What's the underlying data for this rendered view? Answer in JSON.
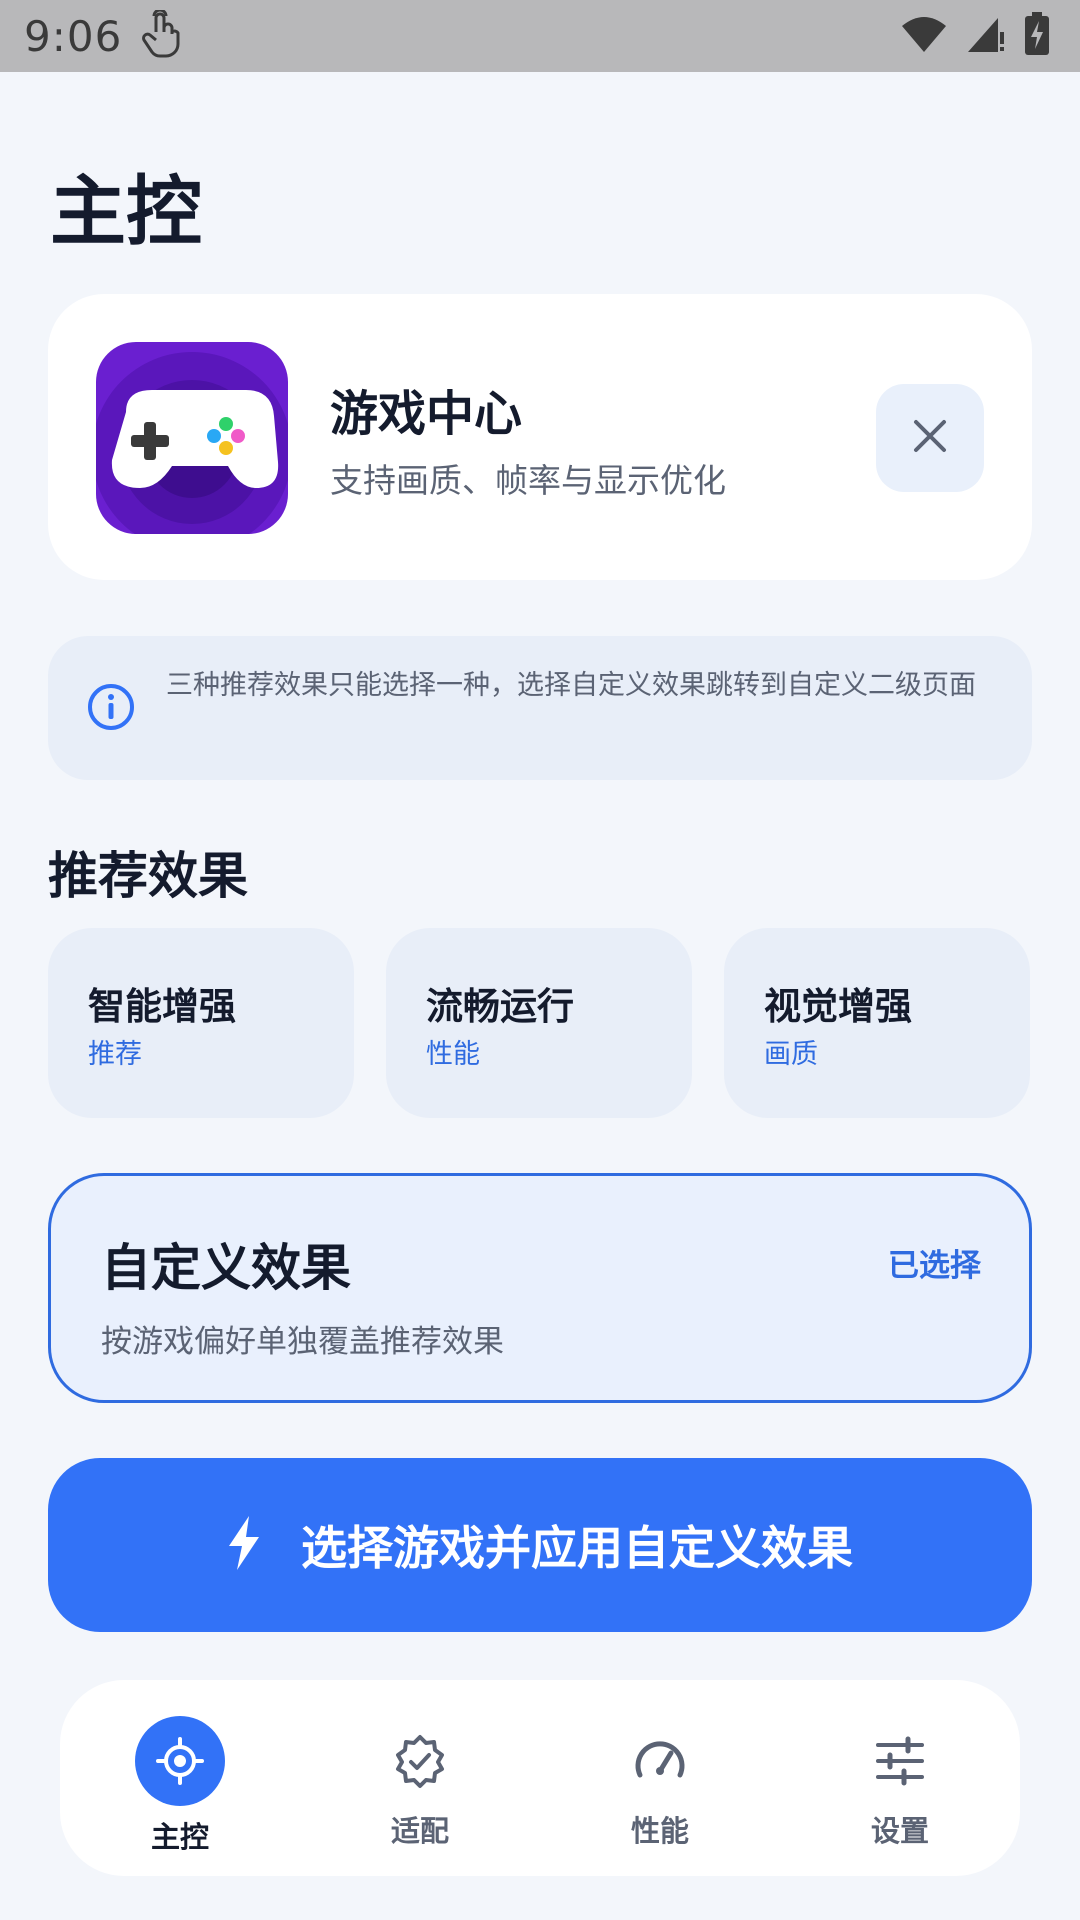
{
  "status_bar": {
    "time": "9:06",
    "icons": [
      "touch-icon",
      "wifi-icon",
      "signal-icon",
      "battery-charging-icon"
    ]
  },
  "page": {
    "title": "主控"
  },
  "app_card": {
    "name": "游戏中心",
    "description": "支持画质、帧率与显示优化",
    "icon": "gamepad-icon",
    "close_icon": "close-icon"
  },
  "info": {
    "icon": "info-icon",
    "text": "三种推荐效果只能选择一种，选择自定义效果跳转到自定义二级页面"
  },
  "presets": {
    "title": "推荐效果",
    "items": [
      {
        "name": "智能增强",
        "tag": "推荐"
      },
      {
        "name": "流畅运行",
        "tag": "性能"
      },
      {
        "name": "视觉增强",
        "tag": "画质"
      }
    ]
  },
  "custom": {
    "title": "自定义效果",
    "status": "已选择",
    "description": "按游戏偏好单独覆盖推荐效果"
  },
  "apply_button": {
    "label": "选择游戏并应用自定义效果",
    "icon": "lightning-icon"
  },
  "nav": {
    "items": [
      {
        "label": "主控",
        "icon": "target-icon",
        "active": true
      },
      {
        "label": "适配",
        "icon": "verified-badge-icon",
        "active": false
      },
      {
        "label": "性能",
        "icon": "speedometer-icon",
        "active": false
      },
      {
        "label": "设置",
        "icon": "sliders-icon",
        "active": false
      }
    ]
  },
  "colors": {
    "accent": "#3272f7",
    "accent_text": "#2f6be0",
    "background": "#f3f6fb",
    "card": "#ffffff",
    "tinted_card": "#e8eef8"
  }
}
